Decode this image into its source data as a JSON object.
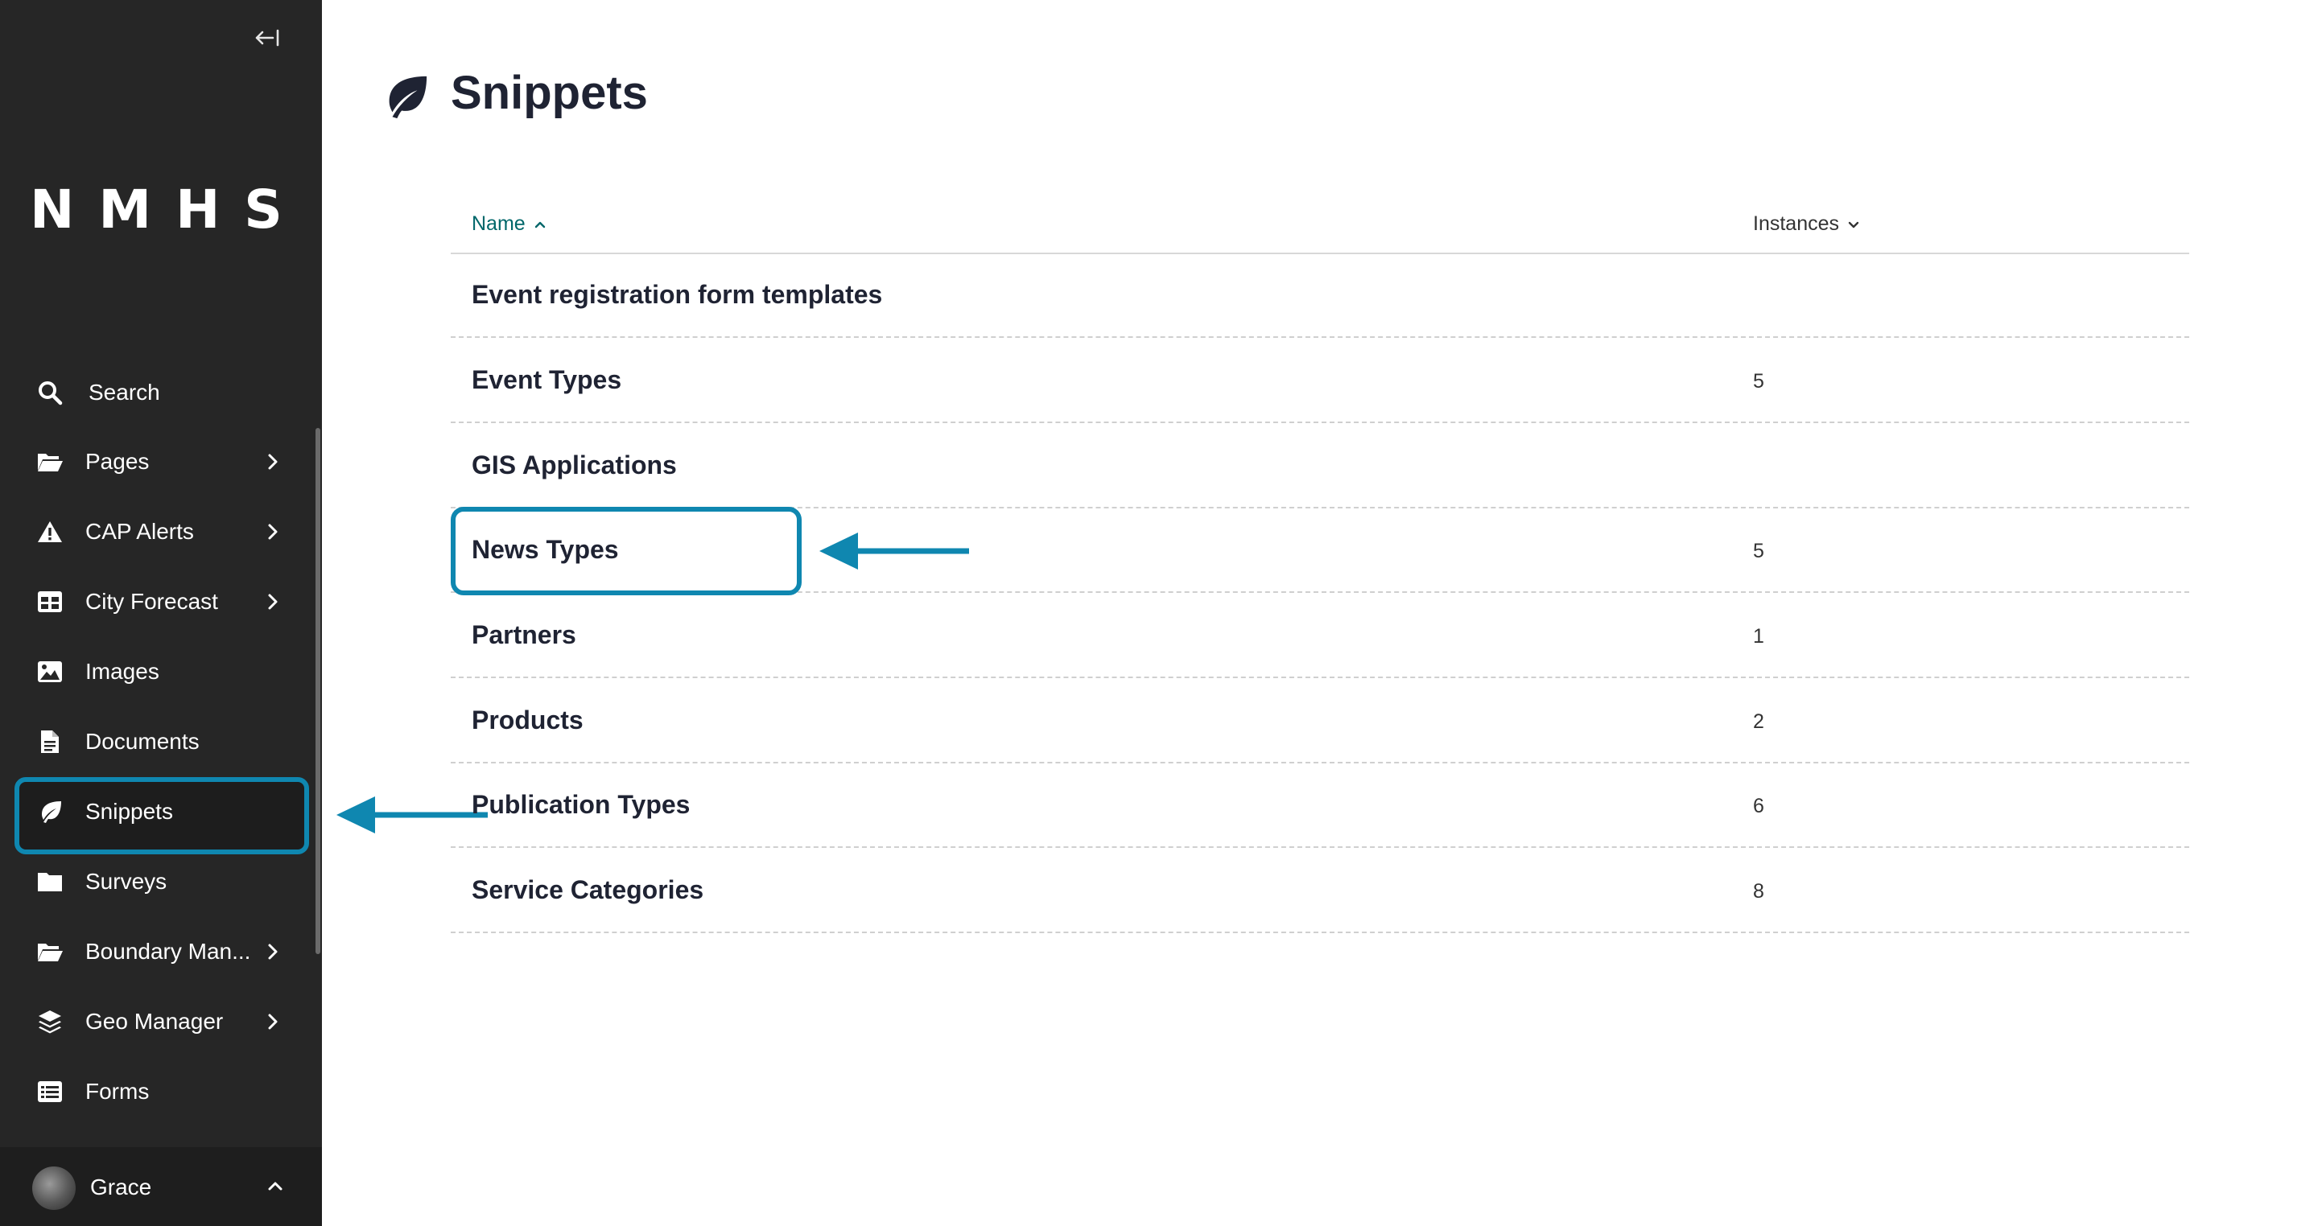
{
  "sidebar": {
    "collapse_glyph": "←|",
    "logo": "NMHS",
    "items": [
      {
        "label": "Search",
        "icon": "search-icon",
        "has_submenu": false
      },
      {
        "label": "Pages",
        "icon": "folder-open-icon",
        "has_submenu": true
      },
      {
        "label": "CAP Alerts",
        "icon": "warning-icon",
        "has_submenu": true
      },
      {
        "label": "City Forecast",
        "icon": "table-icon",
        "has_submenu": true
      },
      {
        "label": "Images",
        "icon": "image-icon",
        "has_submenu": false
      },
      {
        "label": "Documents",
        "icon": "document-icon",
        "has_submenu": false
      },
      {
        "label": "Snippets",
        "icon": "leaf-icon",
        "has_submenu": false,
        "active": true
      },
      {
        "label": "Surveys",
        "icon": "folder-icon",
        "has_submenu": false
      },
      {
        "label": "Boundary Man...",
        "icon": "folder-open-icon",
        "has_submenu": true
      },
      {
        "label": "Geo Manager",
        "icon": "layers-icon",
        "has_submenu": true
      },
      {
        "label": "Forms",
        "icon": "list-icon",
        "has_submenu": false
      }
    ],
    "user": {
      "name": "Grace"
    }
  },
  "main": {
    "title": "Snippets",
    "table": {
      "columns": [
        {
          "label": "Name",
          "sort": "ascending"
        },
        {
          "label": "Instances",
          "sort": "descending"
        }
      ],
      "rows": [
        {
          "name": "Event registration form templates",
          "instances": ""
        },
        {
          "name": "Event Types",
          "instances": "5"
        },
        {
          "name": "GIS Applications",
          "instances": ""
        },
        {
          "name": "News Types",
          "instances": "5"
        },
        {
          "name": "Partners",
          "instances": "1"
        },
        {
          "name": "Products",
          "instances": "2"
        },
        {
          "name": "Publication Types",
          "instances": "6"
        },
        {
          "name": "Service Categories",
          "instances": "8"
        }
      ]
    }
  },
  "colors": {
    "sidebar_bg": "#262626",
    "highlight": "#0f87b0",
    "sort_link": "#00676a",
    "heading": "#1f2333"
  }
}
